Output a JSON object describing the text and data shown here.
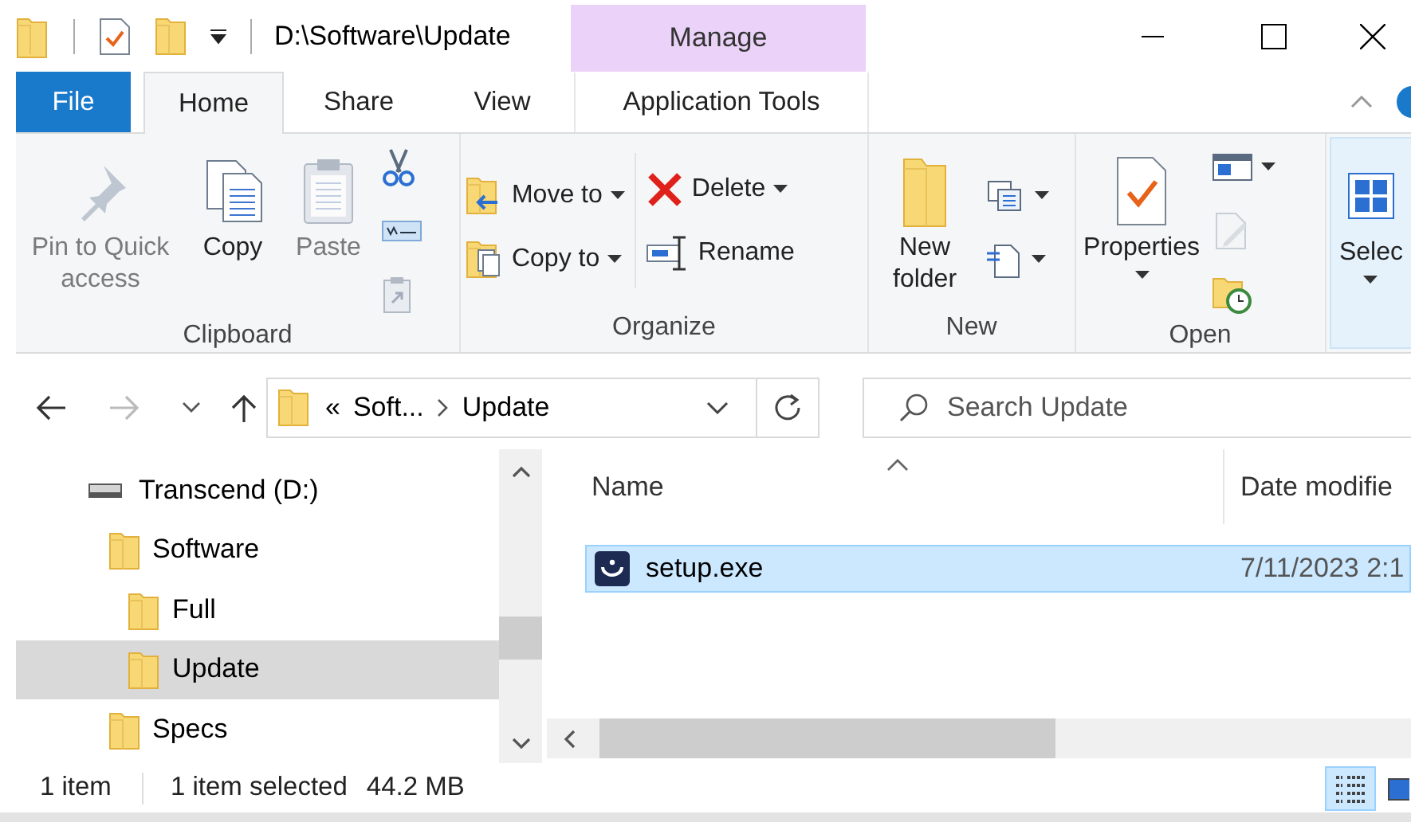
{
  "title_bar": {
    "title": "D:\\Software\\Update",
    "context_tab": "Manage"
  },
  "ribbon_tabs": [
    {
      "label": "File",
      "kind": "file",
      "selected": false
    },
    {
      "label": "Home",
      "kind": "plain",
      "selected": true
    },
    {
      "label": "Share",
      "kind": "plain",
      "selected": false
    },
    {
      "label": "View",
      "kind": "plain",
      "selected": false
    },
    {
      "label": "Application Tools",
      "kind": "contextual",
      "selected": false
    }
  ],
  "ribbon_groups": [
    {
      "label": "Clipboard",
      "highlighted": false,
      "columns": [
        [
          {
            "label": "Pin to Quick access",
            "kind": "large",
            "dropdown": false,
            "disabled": true
          }
        ],
        [
          {
            "label": "Copy",
            "kind": "large",
            "dropdown": false,
            "disabled": false
          }
        ],
        [
          {
            "label": "Paste",
            "kind": "large",
            "dropdown": false,
            "disabled": true
          }
        ],
        [
          {
            "kind": "small",
            "dropdown": false,
            "disabled": false
          },
          {
            "kind": "small",
            "dropdown": false,
            "disabled": false
          },
          {
            "kind": "small",
            "dropdown": false,
            "disabled": true
          }
        ]
      ]
    },
    {
      "label": "Organize",
      "highlighted": false,
      "columns": [
        [
          {
            "label": "Move to",
            "kind": "small",
            "dropdown": true,
            "disabled": false
          },
          {
            "label": "Copy to",
            "kind": "small",
            "dropdown": true,
            "disabled": false
          }
        ],
        [
          {
            "label": "Delete",
            "kind": "small",
            "dropdown": true,
            "disabled": false
          },
          {
            "label": "Rename",
            "kind": "small",
            "dropdown": false,
            "disabled": false
          }
        ]
      ]
    },
    {
      "label": "New",
      "highlighted": false,
      "columns": [
        [
          {
            "label": "New folder",
            "kind": "large",
            "dropdown": false,
            "disabled": false
          }
        ],
        [
          {
            "kind": "small",
            "dropdown": true,
            "disabled": false
          },
          {
            "kind": "small",
            "dropdown": true,
            "disabled": false
          }
        ]
      ]
    },
    {
      "label": "Open",
      "highlighted": false,
      "columns": [
        [
          {
            "label": "Properties",
            "kind": "large",
            "dropdown": true,
            "disabled": false
          }
        ],
        [
          {
            "kind": "small",
            "dropdown": true,
            "disabled": false
          },
          {
            "kind": "small",
            "dropdown": false,
            "disabled": true
          },
          {
            "kind": "small",
            "dropdown": false,
            "disabled": false
          }
        ]
      ]
    },
    {
      "highlighted": true,
      "columns": [
        [
          {
            "label": "Selec",
            "kind": "large",
            "dropdown": true,
            "disabled": false
          }
        ]
      ]
    }
  ],
  "address_bar": {
    "overflow_mark": "«",
    "segments": [
      "Soft...",
      "Update"
    ]
  },
  "search": {
    "placeholder": "Search Update"
  },
  "nav_tree": [
    {
      "label": "Transcend (D:)",
      "kind": "drive",
      "selected": false,
      "children": [
        {
          "label": "Software",
          "kind": "folder",
          "selected": false,
          "children": [
            {
              "label": "Full",
              "kind": "folder",
              "selected": false
            },
            {
              "label": "Update",
              "kind": "folder",
              "selected": true
            }
          ]
        },
        {
          "label": "Specs",
          "kind": "folder",
          "selected": false
        }
      ]
    }
  ],
  "file_list": {
    "columns": [
      "Name",
      "Date modifie"
    ],
    "rows": [
      {
        "name": "setup.exe",
        "date": "7/11/2023 2:1",
        "selected": true
      }
    ]
  },
  "status_bar": {
    "item_count": "1 item",
    "selection": "1 item selected",
    "size": "44.2 MB"
  },
  "view_buttons": [
    {
      "kind": "details",
      "selected": true
    },
    {
      "kind": "large_icons",
      "selected": false
    }
  ]
}
